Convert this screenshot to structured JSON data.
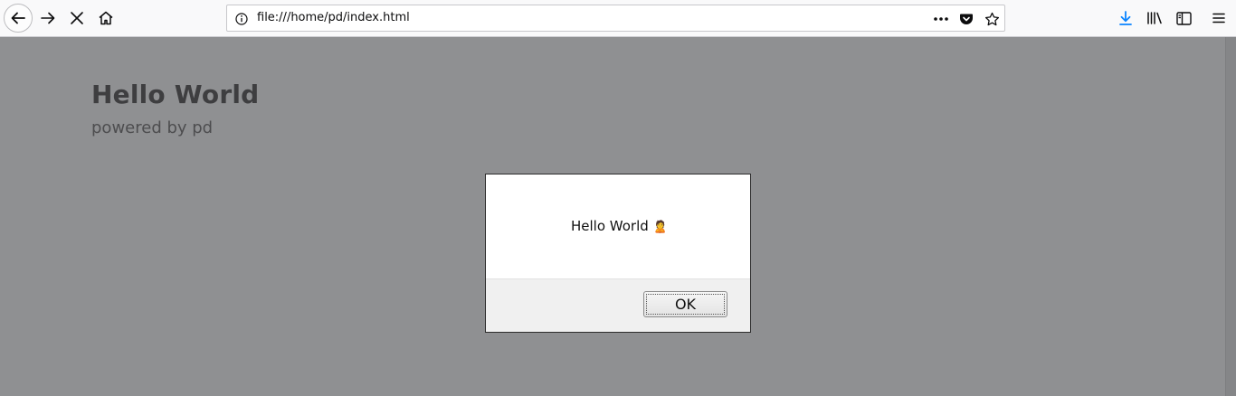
{
  "browser": {
    "url": "file:///home/pd/index.html",
    "icons": {
      "back": "back-arrow-icon",
      "forward": "forward-arrow-icon",
      "stop": "stop-loading-icon",
      "home": "home-icon",
      "info": "page-info-icon",
      "more": "page-actions-icon",
      "pocket": "pocket-icon",
      "bookmark": "bookmark-star-icon",
      "downloads": "downloads-icon",
      "library": "library-icon",
      "sidebar": "sidebar-icon",
      "menu": "hamburger-menu-icon"
    },
    "colors": {
      "download_accent": "#0a84ff",
      "overlay": "#8f9092"
    }
  },
  "page": {
    "title": "Hello World",
    "subtitle": "powered by pd"
  },
  "dialog": {
    "message": "Hello World",
    "emoji": "🙎",
    "ok_label": "OK"
  }
}
